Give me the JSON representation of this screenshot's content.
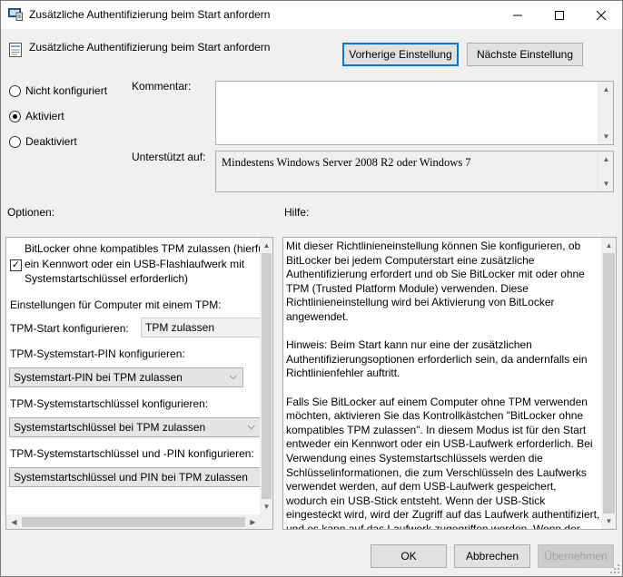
{
  "window": {
    "title": "Zusätzliche Authentifizierung beim Start anfordern"
  },
  "header": {
    "policy_title": "Zusätzliche Authentifizierung beim Start anfordern",
    "prev_button": "Vorherige Einstellung",
    "next_button": "Nächste Einstellung"
  },
  "state": {
    "options": [
      "Nicht konfiguriert",
      "Aktiviert",
      "Deaktiviert"
    ],
    "selected": "Aktiviert"
  },
  "comment": {
    "label": "Kommentar:",
    "value": ""
  },
  "supported": {
    "label": "Unterstützt auf:",
    "value": "Mindestens Windows Server 2008 R2 oder Windows 7"
  },
  "options_section": {
    "label": "Optionen:",
    "checkbox_text_1": "BitLocker ohne kompatibles TPM zulassen (hierfü",
    "checkbox_text_2": "ein Kennwort oder ein USB-Flashlaufwerk mit",
    "checkbox_text_3": "Systemstartschlüssel erforderlich)",
    "checkbox_checked": true,
    "tpm_heading": "Einstellungen für Computer mit einem TPM:",
    "tpm_start_label": "TPM-Start konfigurieren:",
    "tpm_start_value": "TPM zulassen",
    "pin_label": "TPM-Systemstart-PIN konfigurieren:",
    "pin_value": "Systemstart-PIN bei TPM zulassen",
    "key_label": "TPM-Systemstartschlüssel konfigurieren:",
    "key_value": "Systemstartschlüssel bei TPM zulassen",
    "keypin_label": "TPM-Systemstartschlüssel und -PIN konfigurieren:",
    "keypin_value": "Systemstartschlüssel und PIN bei TPM zulassen"
  },
  "help_section": {
    "label": "Hilfe:",
    "paragraph_1": "Mit dieser Richtlinieneinstellung können Sie konfigurieren, ob BitLocker bei jedem Computerstart eine zusätzliche Authentifizierung erfordert und ob Sie BitLocker mit oder ohne TPM (Trusted Platform Module) verwenden. Diese Richtlinieneinstellung wird bei Aktivierung von BitLocker angewendet.",
    "paragraph_2": "Hinweis: Beim Start kann nur eine der zusätzlichen Authentifizierungsoptionen erforderlich sein, da andernfalls ein Richtlinienfehler auftritt.",
    "paragraph_3": "Falls Sie BitLocker auf einem Computer ohne TPM verwenden möchten, aktivieren Sie das Kontrollkästchen \"BitLocker ohne kompatibles TPM zulassen\". In diesem Modus ist für den Start entweder ein Kennwort oder ein USB-Laufwerk erforderlich. Bei Verwendung eines Systemstartschlüssels werden die Schlüsselinformationen, die zum Verschlüsseln des Laufwerks verwendet werden, auf dem USB-Laufwerk gespeichert, wodurch ein USB-Stick entsteht. Wenn der USB-Stick eingesteckt wird, wird der Zugriff auf das Laufwerk authentifiziert, und es kann auf das Laufwerk zugegriffen werden. Wenn der USB-Stick verloren"
  },
  "footer": {
    "ok": "OK",
    "cancel": "Abbrechen",
    "apply": "Übernehmen"
  }
}
